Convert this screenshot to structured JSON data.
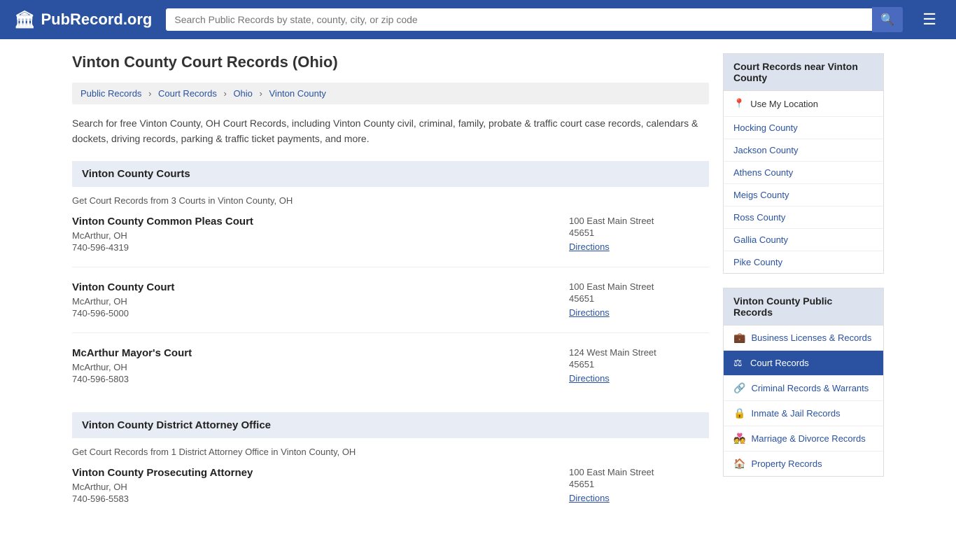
{
  "header": {
    "logo_icon": "🏛",
    "logo_text": "PubRecord.org",
    "search_placeholder": "Search Public Records by state, county, city, or zip code",
    "search_icon": "🔍",
    "menu_icon": "☰"
  },
  "page": {
    "title": "Vinton County Court Records (Ohio)",
    "description": "Search for free Vinton County, OH Court Records, including Vinton County civil, criminal, family, probate & traffic court case records, calendars & dockets, driving records, parking & traffic ticket payments, and more."
  },
  "breadcrumb": {
    "items": [
      {
        "label": "Public Records",
        "href": "#"
      },
      {
        "label": "Court Records",
        "href": "#"
      },
      {
        "label": "Ohio",
        "href": "#"
      },
      {
        "label": "Vinton County",
        "href": "#"
      }
    ]
  },
  "courts_section": {
    "header": "Vinton County Courts",
    "count_text": "Get Court Records from 3 Courts in Vinton County, OH",
    "courts": [
      {
        "name": "Vinton County Common Pleas Court",
        "city": "McArthur, OH",
        "phone": "740-596-4319",
        "address": "100 East Main Street",
        "zip": "45651",
        "directions_label": "Directions"
      },
      {
        "name": "Vinton County Court",
        "city": "McArthur, OH",
        "phone": "740-596-5000",
        "address": "100 East Main Street",
        "zip": "45651",
        "directions_label": "Directions"
      },
      {
        "name": "McArthur Mayor's Court",
        "city": "McArthur, OH",
        "phone": "740-596-5803",
        "address": "124 West Main Street",
        "zip": "45651",
        "directions_label": "Directions"
      }
    ]
  },
  "attorney_section": {
    "header": "Vinton County District Attorney Office",
    "count_text": "Get Court Records from 1 District Attorney Office in Vinton County, OH",
    "courts": [
      {
        "name": "Vinton County Prosecuting Attorney",
        "city": "McArthur, OH",
        "phone": "740-596-5583",
        "address": "100 East Main Street",
        "zip": "45651",
        "directions_label": "Directions"
      }
    ]
  },
  "sidebar": {
    "nearby_header": "Court Records near Vinton County",
    "use_my_location": "Use My Location",
    "location_icon": "📍",
    "nearby_counties": [
      "Hocking County",
      "Jackson County",
      "Athens County",
      "Meigs County",
      "Ross County",
      "Gallia County",
      "Pike County"
    ],
    "records_header": "Vinton County Public Records",
    "record_items": [
      {
        "label": "Business Licenses & Records",
        "icon": "💼",
        "active": false
      },
      {
        "label": "Court Records",
        "icon": "⚖",
        "active": true
      },
      {
        "label": "Criminal Records & Warrants",
        "icon": "🔗",
        "active": false
      },
      {
        "label": "Inmate & Jail Records",
        "icon": "🔒",
        "active": false
      },
      {
        "label": "Marriage & Divorce Records",
        "icon": "💑",
        "active": false
      },
      {
        "label": "Property Records",
        "icon": "🏠",
        "active": false
      }
    ]
  }
}
